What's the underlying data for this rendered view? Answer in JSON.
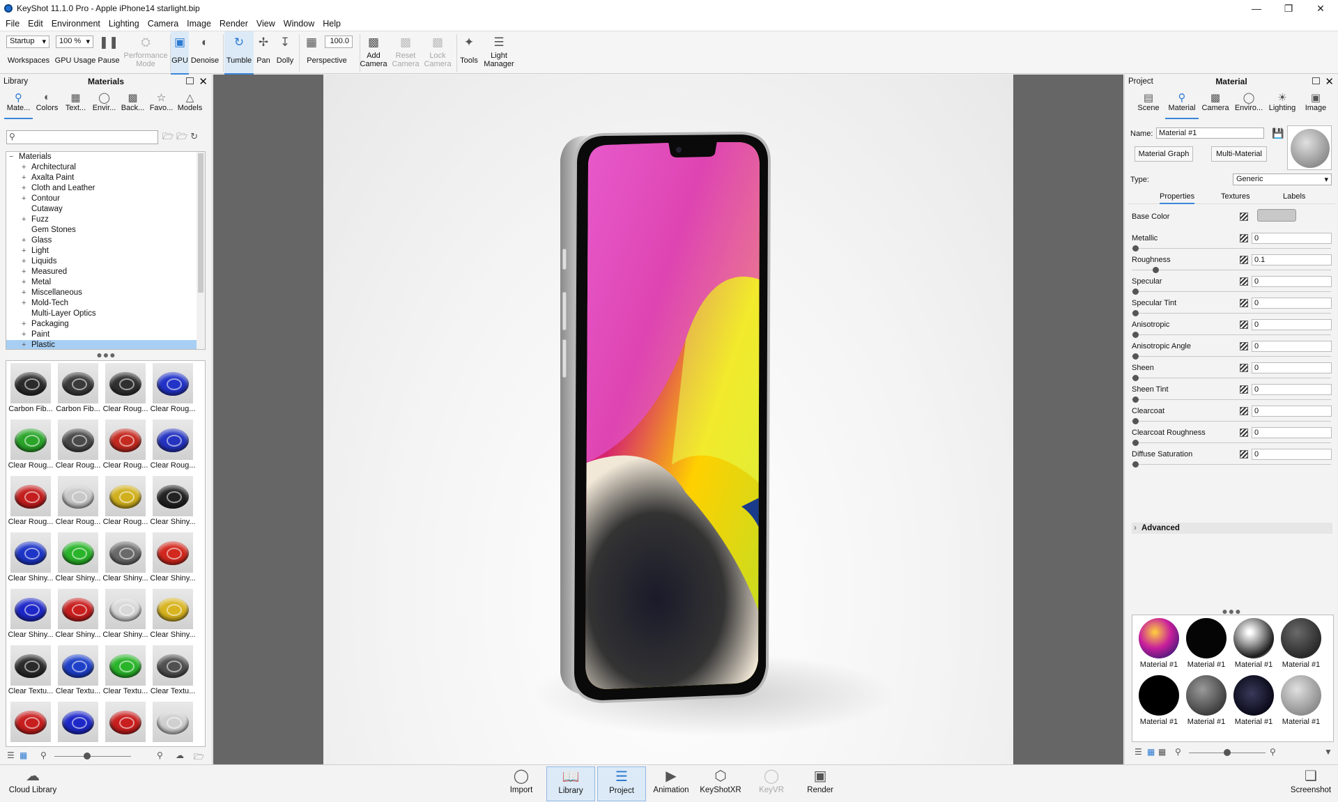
{
  "window": {
    "title": "KeyShot 11.1.0 Pro - Apple iPhone14 starlight.bip"
  },
  "menu": [
    "File",
    "Edit",
    "Environment",
    "Lighting",
    "Camera",
    "Image",
    "Render",
    "View",
    "Window",
    "Help"
  ],
  "toolbar": {
    "workspace_value": "Startup",
    "workspaces_label": "Workspaces",
    "gpu_usage_value": "100 %",
    "gpu_usage_label": "GPU Usage",
    "pause_label": "Pause",
    "performance_label": "Performance Mode",
    "gpu_label": "GPU",
    "denoise_label": "Denoise",
    "tumble_label": "Tumble",
    "pan_label": "Pan",
    "dolly_label": "Dolly",
    "perspective_value": "100.0",
    "perspective_label": "Perspective",
    "add_camera_label": "Add Camera",
    "reset_camera_label": "Reset Camera",
    "lock_camera_label": "Lock Camera",
    "tools_label": "Tools",
    "light_manager_label": "Light Manager"
  },
  "library": {
    "header_left": "Library",
    "header_title": "Materials",
    "tabs": [
      "Mate...",
      "Colors",
      "Text...",
      "Envir...",
      "Back...",
      "Favo...",
      "Models"
    ],
    "search_placeholder": "",
    "tree_root": "Materials",
    "tree_items": [
      {
        "label": "Architectural",
        "expandable": true
      },
      {
        "label": "Axalta Paint",
        "expandable": true
      },
      {
        "label": "Cloth and Leather",
        "expandable": true
      },
      {
        "label": "Contour",
        "expandable": true
      },
      {
        "label": "Cutaway",
        "expandable": false
      },
      {
        "label": "Fuzz",
        "expandable": true
      },
      {
        "label": "Gem Stones",
        "expandable": false
      },
      {
        "label": "Glass",
        "expandable": true
      },
      {
        "label": "Light",
        "expandable": true
      },
      {
        "label": "Liquids",
        "expandable": true
      },
      {
        "label": "Measured",
        "expandable": true
      },
      {
        "label": "Metal",
        "expandable": true
      },
      {
        "label": "Miscellaneous",
        "expandable": true
      },
      {
        "label": "Mold-Tech",
        "expandable": true
      },
      {
        "label": "Multi-Layer Optics",
        "expandable": false
      },
      {
        "label": "Packaging",
        "expandable": true
      },
      {
        "label": "Paint",
        "expandable": true
      },
      {
        "label": "Plastic",
        "expandable": true
      }
    ],
    "selected_item": "Plastic",
    "thumbnails": [
      {
        "label": "Carbon Fib...",
        "color": "#2b2b2b"
      },
      {
        "label": "Carbon Fib...",
        "color": "#3a3a3a"
      },
      {
        "label": "Clear Roug...",
        "color": "#303030"
      },
      {
        "label": "Clear Roug...",
        "color": "#2233c8"
      },
      {
        "label": "Clear Roug...",
        "color": "#2aa52a"
      },
      {
        "label": "Clear Roug...",
        "color": "#4a4a4a"
      },
      {
        "label": "Clear Roug...",
        "color": "#c42a20"
      },
      {
        "label": "Clear Roug...",
        "color": "#2433c0"
      },
      {
        "label": "Clear Roug...",
        "color": "#c41e1e"
      },
      {
        "label": "Clear Roug...",
        "color": "#c8c8c8"
      },
      {
        "label": "Clear Roug...",
        "color": "#d1b01e"
      },
      {
        "label": "Clear Shiny...",
        "color": "#222222"
      },
      {
        "label": "Clear Shiny...",
        "color": "#1e36c8"
      },
      {
        "label": "Clear Shiny...",
        "color": "#2ab42a"
      },
      {
        "label": "Clear Shiny...",
        "color": "#6a6a6a"
      },
      {
        "label": "Clear Shiny...",
        "color": "#d2281e"
      },
      {
        "label": "Clear Shiny...",
        "color": "#1e28c8"
      },
      {
        "label": "Clear Shiny...",
        "color": "#c81e1e"
      },
      {
        "label": "Clear Shiny...",
        "color": "#d8d8d8"
      },
      {
        "label": "Clear Shiny...",
        "color": "#d8b420"
      },
      {
        "label": "Clear Textu...",
        "color": "#2a2a2a"
      },
      {
        "label": "Clear Textu...",
        "color": "#1e40c8"
      },
      {
        "label": "Clear Textu...",
        "color": "#2ab42a"
      },
      {
        "label": "Clear Textu...",
        "color": "#505050"
      },
      {
        "label": "",
        "color": "#c81e1e"
      },
      {
        "label": "",
        "color": "#1e28c8"
      },
      {
        "label": "",
        "color": "#c81e1e"
      },
      {
        "label": "",
        "color": "#d0d0d0"
      }
    ]
  },
  "project": {
    "header_left": "Project",
    "header_title": "Material",
    "tabs": [
      "Scene",
      "Material",
      "Camera",
      "Enviro...",
      "Lighting",
      "Image"
    ],
    "name_label": "Name:",
    "name_value": "Material  #1",
    "material_graph_label": "Material Graph",
    "multi_material_label": "Multi-Material",
    "type_label": "Type:",
    "type_value": "Generic",
    "subtabs": [
      "Properties",
      "Textures",
      "Labels"
    ],
    "base_color_label": "Base Color",
    "base_color": "#c8c8c8",
    "properties": [
      {
        "name": "Metallic",
        "value": "0",
        "level": 0
      },
      {
        "name": "Roughness",
        "value": "0.1",
        "level": 0.1
      },
      {
        "name": "Specular",
        "value": "0",
        "level": 0
      },
      {
        "name": "Specular Tint",
        "value": "0",
        "level": 0
      },
      {
        "name": "Anisotropic",
        "value": "0",
        "level": 0
      },
      {
        "name": "Anisotropic Angle",
        "value": "0",
        "level": 0
      },
      {
        "name": "Sheen",
        "value": "0",
        "level": 0
      },
      {
        "name": "Sheen Tint",
        "value": "0",
        "level": 0
      },
      {
        "name": "Clearcoat",
        "value": "0",
        "level": 0
      },
      {
        "name": "Clearcoat Roughness",
        "value": "0",
        "level": 0
      },
      {
        "name": "Diffuse Saturation",
        "value": "0",
        "level": 0
      }
    ],
    "advanced_label": "Advanced",
    "materials": [
      {
        "label": "Material  #1",
        "style": "radial-gradient(circle at 40% 35%, #ffd23c, #c81e9c 45%, #4a1a7a 80%)"
      },
      {
        "label": "Material  #1",
        "style": "#050505"
      },
      {
        "label": "Material  #1",
        "style": "radial-gradient(circle at 40% 35%, #ffffff 5%, #9a9a9a 35%, #1a1a1a 70%, #e0e0e0 95%)"
      },
      {
        "label": "Material  #1",
        "style": "radial-gradient(circle at 40% 35%, #6a6a6a, #2a2a2a 70%)"
      },
      {
        "label": "Material  #1",
        "style": "#000000"
      },
      {
        "label": "Material  #1",
        "style": "radial-gradient(circle at 40% 35%, #9a9a9a, #3a3a3a 75%)"
      },
      {
        "label": "Material  #1",
        "style": "radial-gradient(circle at 45% 45%, #3a3a5a, #0a0a1a 70%)"
      },
      {
        "label": "Material  #1",
        "style": "radial-gradient(circle at 40% 35%, #e0e0e0, #8a8a8a 75%)"
      }
    ]
  },
  "bottombar": {
    "cloud_library_label": "Cloud Library",
    "import_label": "Import",
    "library_label": "Library",
    "project_label": "Project",
    "animation_label": "Animation",
    "keyshotxr_label": "KeyShotXR",
    "keyvr_label": "KeyVR",
    "render_label": "Render",
    "screenshot_label": "Screenshot"
  }
}
